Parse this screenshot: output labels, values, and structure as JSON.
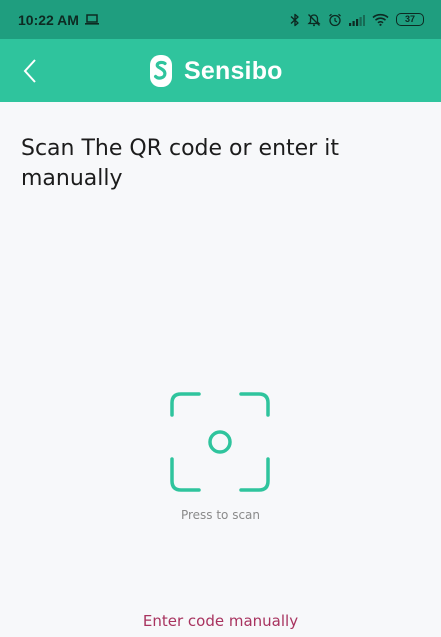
{
  "status_bar": {
    "time": "10:22 AM",
    "battery": "37",
    "icons": [
      "laptop-icon",
      "bluetooth-icon",
      "notifications-off-icon",
      "alarm-icon",
      "signal-icon",
      "wifi-icon",
      "battery-icon"
    ]
  },
  "app_bar": {
    "brand_name": "Sensibo",
    "back_icon": "chevron-left-icon",
    "logo_icon": "sensibo-logo-icon"
  },
  "main": {
    "title": "Scan The QR code or enter it manually",
    "scan_icon": "scan-frame-icon",
    "scan_caption": "Press to scan",
    "manual_link": "Enter code manually"
  },
  "colors": {
    "status_bar": "#1f9e7f",
    "app_bar": "#2fc49d",
    "accent": "#2fc49d",
    "link": "#a8335f",
    "background": "#f7f8fa"
  }
}
